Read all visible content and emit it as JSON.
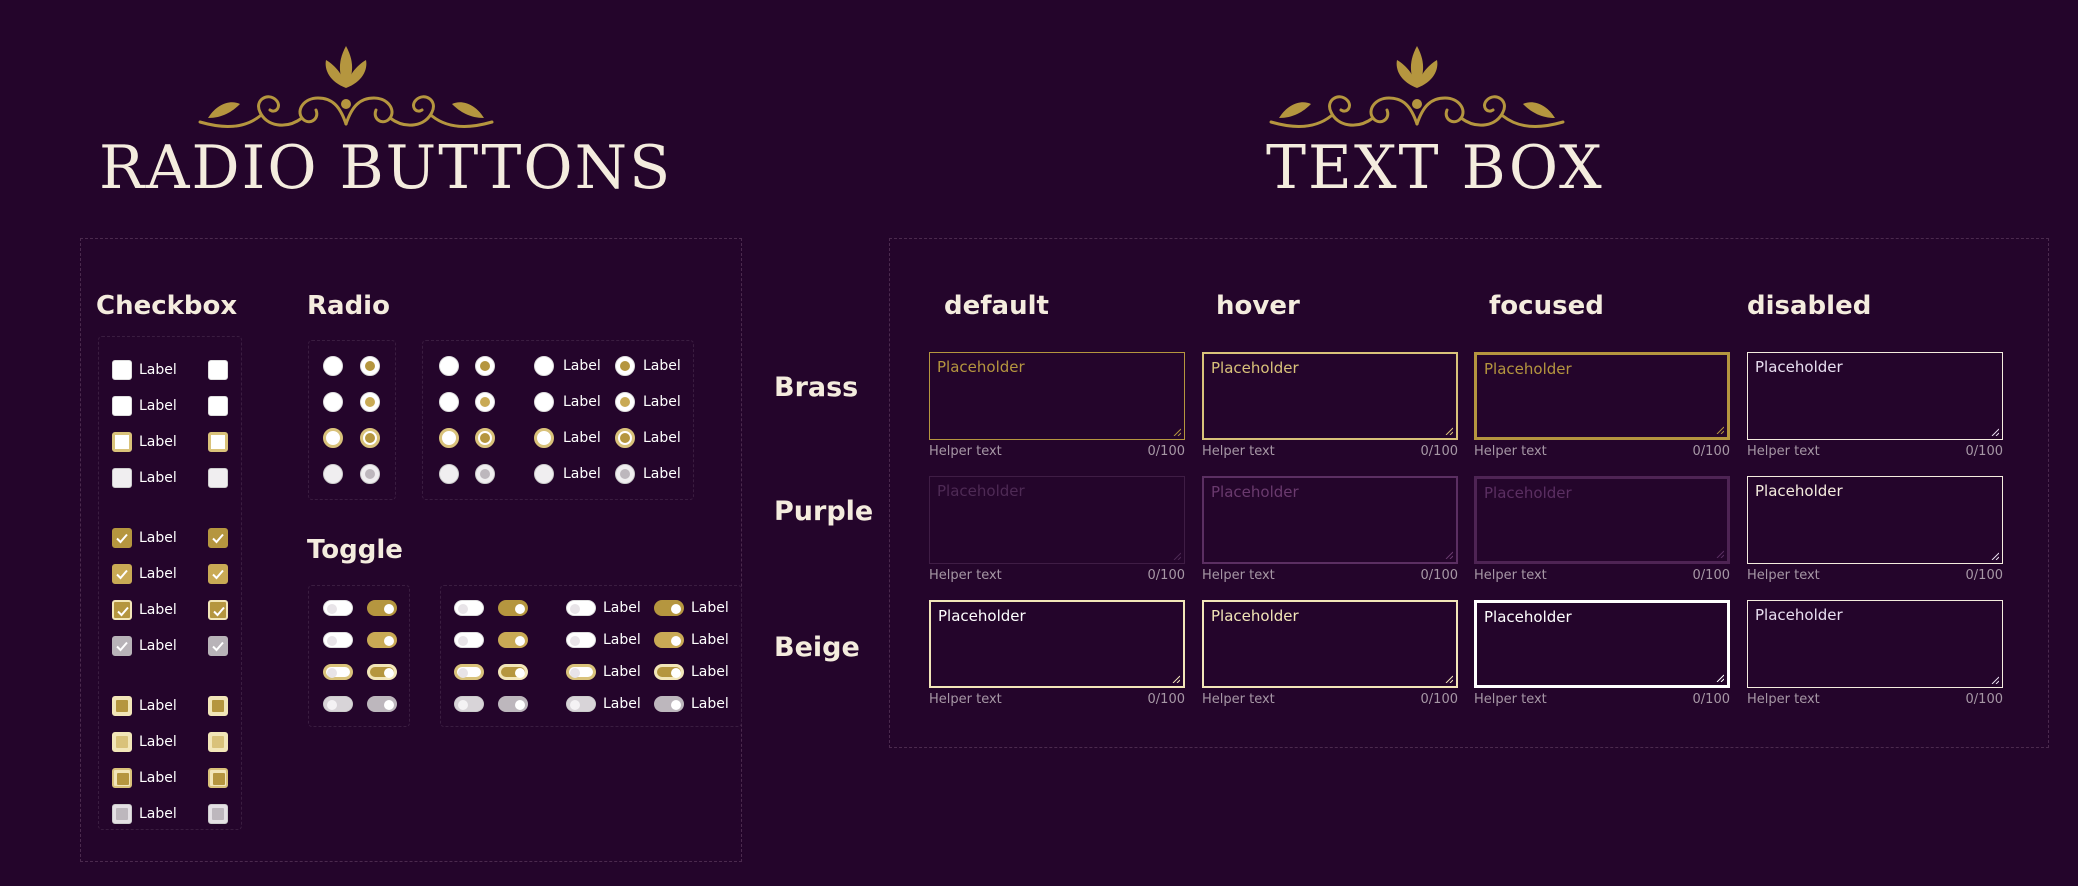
{
  "titles": {
    "left": "RADIO BUTTONS",
    "right": "TEXT BOX"
  },
  "colors": {
    "background": "#24052b",
    "brass": "#b5963f",
    "brass_light": "#d9c27a",
    "purple": "#6a3a6e",
    "beige": "#f2e6b8",
    "cream": "#f4ecde"
  },
  "checkbox": {
    "heading": "Checkbox",
    "item_label": "Label"
  },
  "radio": {
    "heading": "Radio",
    "item_label": "Label"
  },
  "toggle": {
    "heading": "Toggle",
    "item_label": "Label"
  },
  "textbox": {
    "states": [
      "default",
      "hover",
      "focused",
      "disabled"
    ],
    "variants": [
      "Brass",
      "Purple",
      "Beige"
    ],
    "placeholder": "Placeholder",
    "helper": "Helper text",
    "counter": "0/100"
  }
}
